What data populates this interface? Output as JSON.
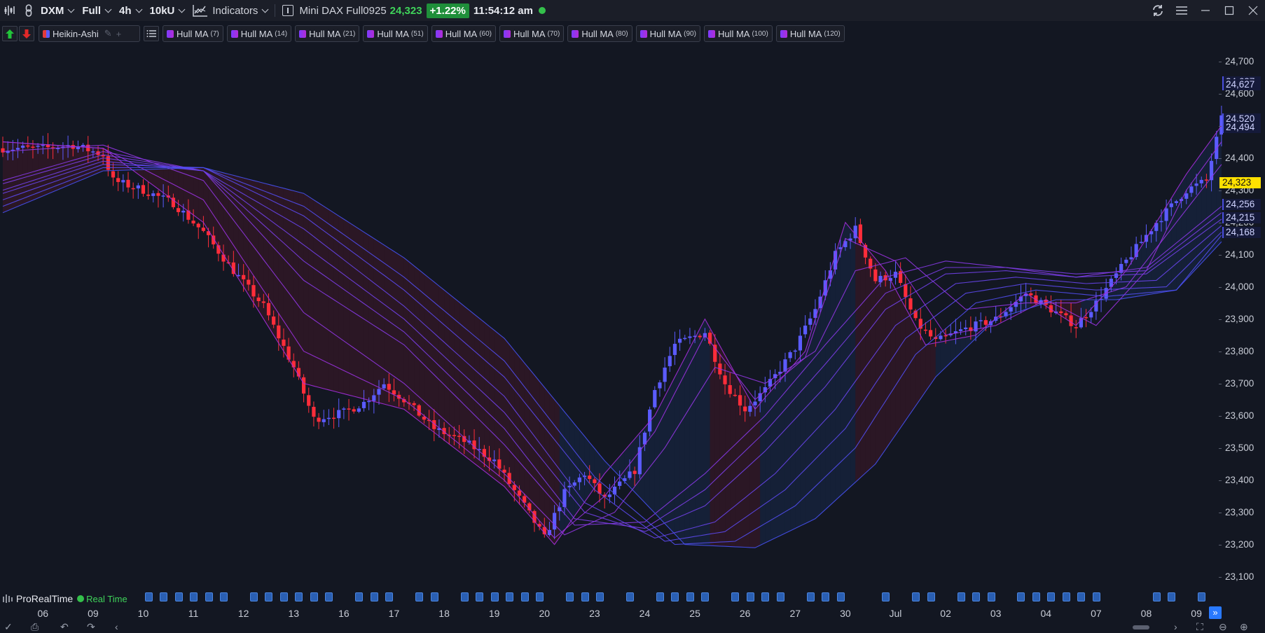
{
  "toolbar": {
    "instrument": "DXM",
    "view": "Full",
    "timeframe": "4h",
    "units": "10kU",
    "indicators_label": "Indicators",
    "instrument_name": "Mini DAX Full0925",
    "last_price": "24,323",
    "change_pct": "+1.22%",
    "time": "11:54:12 am"
  },
  "indicators": {
    "price_type": "Heikin-Ashi",
    "hull": [
      {
        "name": "Hull MA",
        "period": "(7)"
      },
      {
        "name": "Hull MA",
        "period": "(14)"
      },
      {
        "name": "Hull MA",
        "period": "(21)"
      },
      {
        "name": "Hull MA",
        "period": "(51)"
      },
      {
        "name": "Hull MA",
        "period": "(60)"
      },
      {
        "name": "Hull MA",
        "period": "(70)"
      },
      {
        "name": "Hull MA",
        "period": "(80)"
      },
      {
        "name": "Hull MA",
        "period": "(90)"
      },
      {
        "name": "Hull MA",
        "period": "(100)"
      },
      {
        "name": "Hull MA",
        "period": "(120)"
      }
    ]
  },
  "price_axis": {
    "ticks": [
      "24,700",
      "24,600",
      "24,500",
      "24,400",
      "24,300",
      "24,200",
      "24,100",
      "24,000",
      "23,900",
      "23,800",
      "23,700",
      "23,600",
      "23,500",
      "23,400",
      "23,300",
      "23,200",
      "23,100"
    ],
    "tick_values": [
      24700,
      24600,
      24500,
      24400,
      24300,
      24200,
      24100,
      24000,
      23900,
      23800,
      23700,
      23600,
      23500,
      23400,
      23300,
      23200,
      23100
    ],
    "value_labels": [
      "24,637",
      "24,627",
      "24,520",
      "24,494",
      "24,256",
      "24,215",
      "24,168"
    ],
    "value_label_values": [
      24637,
      24627,
      24520,
      24494,
      24256,
      24215,
      24168
    ],
    "last_price_value": 24323,
    "last_price_label": "24,323"
  },
  "time_axis": {
    "labels": [
      "06",
      "09",
      "10",
      "11",
      "12",
      "13",
      "16",
      "17",
      "18",
      "19",
      "20",
      "23",
      "24",
      "25",
      "26",
      "27",
      "30",
      "Jul",
      "02",
      "03",
      "04",
      "07",
      "08",
      "09"
    ]
  },
  "footer": {
    "brand": "ProRealTime",
    "realtime_label": "Real Time",
    "event_marker": "R"
  },
  "colors": {
    "background": "#131722",
    "bull_candle": "#5b5bff",
    "bear_candle": "#ff2d3a",
    "hull_line": "#9b2fd6",
    "last_price": "#ffe000",
    "change_positive": "#1f8f3a"
  },
  "chart_data": {
    "type": "candlestick",
    "title": "",
    "price_type": "Heikin-Ashi",
    "ylim": [
      23060,
      24760
    ],
    "x_tick_labels": [
      "06",
      "09",
      "10",
      "11",
      "12",
      "13",
      "16",
      "17",
      "18",
      "19",
      "20",
      "23",
      "24",
      "25",
      "26",
      "27",
      "30",
      "Jul",
      "02",
      "03",
      "04",
      "07",
      "08",
      "09"
    ],
    "x_tick_session_index": [
      8,
      18,
      28,
      38,
      48,
      58,
      68,
      78,
      88,
      98,
      108,
      118,
      128,
      138,
      148,
      158,
      168,
      178,
      188,
      198,
      208,
      218,
      228,
      238
    ],
    "close_path": [
      [
        0,
        24430
      ],
      [
        8,
        24430
      ],
      [
        14,
        24440
      ],
      [
        20,
        24410
      ],
      [
        22,
        24330
      ],
      [
        28,
        24300
      ],
      [
        34,
        24260
      ],
      [
        40,
        24170
      ],
      [
        46,
        24050
      ],
      [
        52,
        23940
      ],
      [
        58,
        23750
      ],
      [
        62,
        23590
      ],
      [
        68,
        23610
      ],
      [
        72,
        23640
      ],
      [
        76,
        23700
      ],
      [
        80,
        23650
      ],
      [
        86,
        23560
      ],
      [
        92,
        23520
      ],
      [
        98,
        23460
      ],
      [
        104,
        23320
      ],
      [
        108,
        23220
      ],
      [
        112,
        23360
      ],
      [
        116,
        23420
      ],
      [
        120,
        23340
      ],
      [
        126,
        23430
      ],
      [
        130,
        23680
      ],
      [
        134,
        23820
      ],
      [
        140,
        23860
      ],
      [
        144,
        23700
      ],
      [
        148,
        23620
      ],
      [
        152,
        23680
      ],
      [
        158,
        23810
      ],
      [
        162,
        23930
      ],
      [
        166,
        24100
      ],
      [
        170,
        24180
      ],
      [
        174,
        24020
      ],
      [
        178,
        24040
      ],
      [
        182,
        23890
      ],
      [
        186,
        23830
      ],
      [
        192,
        23870
      ],
      [
        198,
        23900
      ],
      [
        204,
        23980
      ],
      [
        210,
        23920
      ],
      [
        214,
        23880
      ],
      [
        218,
        23950
      ],
      [
        224,
        24080
      ],
      [
        230,
        24200
      ],
      [
        236,
        24300
      ],
      [
        240,
        24330
      ],
      [
        243,
        24520
      ]
    ],
    "series": [
      {
        "name": "Hull MA (7)",
        "x_axis": "session_index",
        "points": [
          [
            0,
            24450
          ],
          [
            20,
            24430
          ],
          [
            40,
            24200
          ],
          [
            60,
            23700
          ],
          [
            80,
            23620
          ],
          [
            100,
            23380
          ],
          [
            110,
            23200
          ],
          [
            120,
            23420
          ],
          [
            130,
            23600
          ],
          [
            140,
            23900
          ],
          [
            150,
            23620
          ],
          [
            160,
            23800
          ],
          [
            168,
            24200
          ],
          [
            176,
            24050
          ],
          [
            184,
            23820
          ],
          [
            194,
            23850
          ],
          [
            204,
            23980
          ],
          [
            214,
            23880
          ],
          [
            224,
            24050
          ],
          [
            236,
            24350
          ],
          [
            243,
            24500
          ]
        ]
      },
      {
        "name": "Hull MA (14)",
        "x_axis": "session_index",
        "points": [
          [
            0,
            24450
          ],
          [
            20,
            24430
          ],
          [
            40,
            24270
          ],
          [
            60,
            23800
          ],
          [
            80,
            23650
          ],
          [
            100,
            23400
          ],
          [
            110,
            23220
          ],
          [
            120,
            23350
          ],
          [
            130,
            23550
          ],
          [
            140,
            23850
          ],
          [
            150,
            23650
          ],
          [
            160,
            23780
          ],
          [
            168,
            24150
          ],
          [
            178,
            24080
          ],
          [
            188,
            23850
          ],
          [
            198,
            23880
          ],
          [
            208,
            23960
          ],
          [
            218,
            23880
          ],
          [
            228,
            24050
          ],
          [
            236,
            24300
          ],
          [
            243,
            24450
          ]
        ]
      },
      {
        "name": "Hull MA (21)",
        "x_axis": "session_index",
        "points": [
          [
            0,
            24420
          ],
          [
            20,
            24440
          ],
          [
            40,
            24330
          ],
          [
            60,
            23920
          ],
          [
            80,
            23700
          ],
          [
            100,
            23420
          ],
          [
            112,
            23230
          ],
          [
            122,
            23300
          ],
          [
            132,
            23500
          ],
          [
            142,
            23750
          ],
          [
            152,
            23700
          ],
          [
            162,
            23800
          ],
          [
            170,
            24050
          ],
          [
            180,
            24090
          ],
          [
            192,
            23930
          ],
          [
            204,
            23950
          ],
          [
            214,
            23950
          ],
          [
            224,
            24000
          ],
          [
            234,
            24200
          ],
          [
            243,
            24380
          ]
        ]
      },
      {
        "name": "Hull MA (51)",
        "x_axis": "session_index",
        "points": [
          [
            0,
            24330
          ],
          [
            20,
            24420
          ],
          [
            40,
            24360
          ],
          [
            60,
            24020
          ],
          [
            80,
            23820
          ],
          [
            100,
            23510
          ],
          [
            114,
            23260
          ],
          [
            128,
            23270
          ],
          [
            140,
            23420
          ],
          [
            152,
            23600
          ],
          [
            164,
            23820
          ],
          [
            176,
            24030
          ],
          [
            188,
            24080
          ],
          [
            200,
            24060
          ],
          [
            214,
            24030
          ],
          [
            228,
            24060
          ],
          [
            243,
            24250
          ]
        ]
      },
      {
        "name": "Hull MA (60)",
        "x_axis": "session_index",
        "points": [
          [
            0,
            24320
          ],
          [
            20,
            24410
          ],
          [
            40,
            24360
          ],
          [
            60,
            24080
          ],
          [
            80,
            23860
          ],
          [
            100,
            23560
          ],
          [
            114,
            23280
          ],
          [
            128,
            23250
          ],
          [
            140,
            23370
          ],
          [
            152,
            23550
          ],
          [
            164,
            23760
          ],
          [
            176,
            23980
          ],
          [
            188,
            24060
          ],
          [
            200,
            24060
          ],
          [
            214,
            24040
          ],
          [
            228,
            24050
          ],
          [
            243,
            24230
          ]
        ]
      },
      {
        "name": "Hull MA (70)",
        "x_axis": "session_index",
        "points": [
          [
            0,
            24300
          ],
          [
            20,
            24400
          ],
          [
            40,
            24360
          ],
          [
            60,
            24130
          ],
          [
            80,
            23900
          ],
          [
            100,
            23610
          ],
          [
            116,
            23300
          ],
          [
            128,
            23240
          ],
          [
            140,
            23320
          ],
          [
            152,
            23490
          ],
          [
            164,
            23690
          ],
          [
            176,
            23930
          ],
          [
            188,
            24040
          ],
          [
            200,
            24050
          ],
          [
            214,
            24030
          ],
          [
            228,
            24040
          ],
          [
            243,
            24210
          ]
        ]
      },
      {
        "name": "Hull MA (80)",
        "x_axis": "session_index",
        "points": [
          [
            0,
            24290
          ],
          [
            20,
            24390
          ],
          [
            40,
            24360
          ],
          [
            60,
            24180
          ],
          [
            80,
            23940
          ],
          [
            100,
            23660
          ],
          [
            116,
            23330
          ],
          [
            130,
            23220
          ],
          [
            142,
            23270
          ],
          [
            154,
            23420
          ],
          [
            166,
            23620
          ],
          [
            178,
            23880
          ],
          [
            190,
            24010
          ],
          [
            202,
            24030
          ],
          [
            216,
            24010
          ],
          [
            230,
            24020
          ],
          [
            243,
            24190
          ]
        ]
      },
      {
        "name": "Hull MA (90)",
        "x_axis": "session_index",
        "points": [
          [
            0,
            24270
          ],
          [
            20,
            24380
          ],
          [
            40,
            24370
          ],
          [
            60,
            24220
          ],
          [
            80,
            23990
          ],
          [
            100,
            23720
          ],
          [
            118,
            23370
          ],
          [
            132,
            23210
          ],
          [
            144,
            23240
          ],
          [
            156,
            23370
          ],
          [
            168,
            23560
          ],
          [
            180,
            23840
          ],
          [
            192,
            23980
          ],
          [
            204,
            24010
          ],
          [
            218,
            23990
          ],
          [
            232,
            24000
          ],
          [
            243,
            24170
          ]
        ]
      },
      {
        "name": "Hull MA (100)",
        "x_axis": "session_index",
        "points": [
          [
            0,
            24250
          ],
          [
            20,
            24370
          ],
          [
            40,
            24370
          ],
          [
            60,
            24250
          ],
          [
            80,
            24030
          ],
          [
            100,
            23770
          ],
          [
            118,
            23410
          ],
          [
            134,
            23200
          ],
          [
            146,
            23210
          ],
          [
            158,
            23320
          ],
          [
            170,
            23500
          ],
          [
            182,
            23790
          ],
          [
            194,
            23950
          ],
          [
            206,
            23990
          ],
          [
            220,
            23970
          ],
          [
            234,
            23990
          ],
          [
            243,
            24160
          ]
        ]
      },
      {
        "name": "Hull MA (120)",
        "x_axis": "session_index",
        "points": [
          [
            0,
            24230
          ],
          [
            20,
            24360
          ],
          [
            40,
            24370
          ],
          [
            60,
            24290
          ],
          [
            80,
            24090
          ],
          [
            100,
            23840
          ],
          [
            120,
            23460
          ],
          [
            136,
            23200
          ],
          [
            150,
            23190
          ],
          [
            162,
            23280
          ],
          [
            174,
            23450
          ],
          [
            186,
            23720
          ],
          [
            198,
            23900
          ],
          [
            210,
            23960
          ],
          [
            222,
            23960
          ],
          [
            234,
            23990
          ],
          [
            243,
            24140
          ]
        ]
      }
    ]
  }
}
